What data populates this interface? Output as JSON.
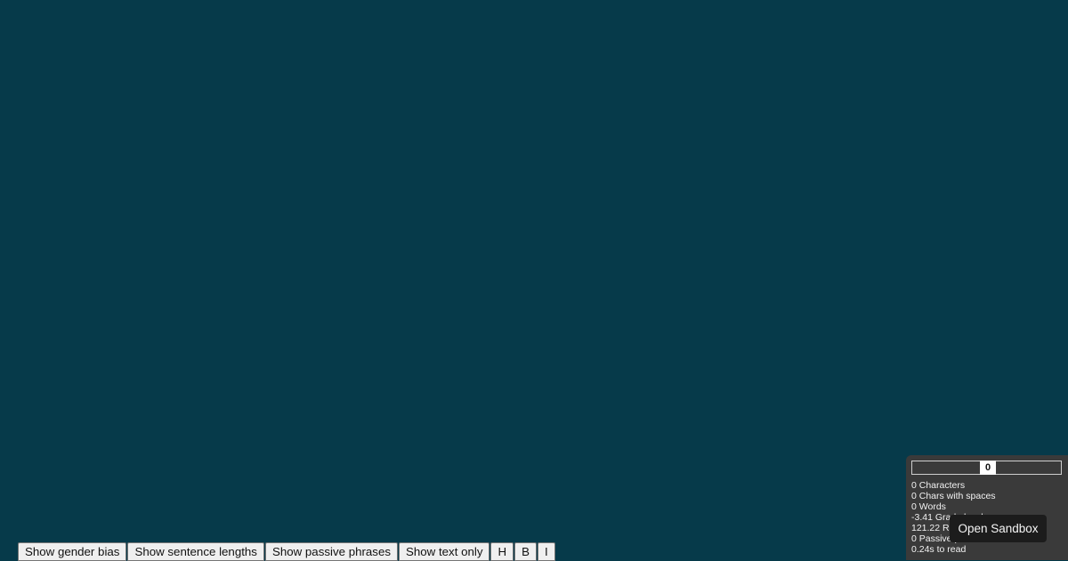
{
  "toolbar": {
    "buttons": [
      {
        "label": "Show gender bias"
      },
      {
        "label": "Show sentence lengths"
      },
      {
        "label": "Show passive phrases"
      },
      {
        "label": "Show text only"
      },
      {
        "label": "H"
      },
      {
        "label": "B"
      },
      {
        "label": "I"
      }
    ]
  },
  "stats": {
    "meter_value": "0",
    "items": [
      "0 Characters",
      "0 Chars with spaces",
      "0 Words",
      "-3.41 Grade level",
      "121.22 Reading ease",
      "0 Passive phrases",
      "0.24s to read"
    ]
  },
  "sandbox": {
    "label": "Open Sandbox"
  },
  "colors": {
    "background": "#063a4a",
    "panel": "#3a3a3a",
    "sandbox_button": "#1c1c1c"
  }
}
